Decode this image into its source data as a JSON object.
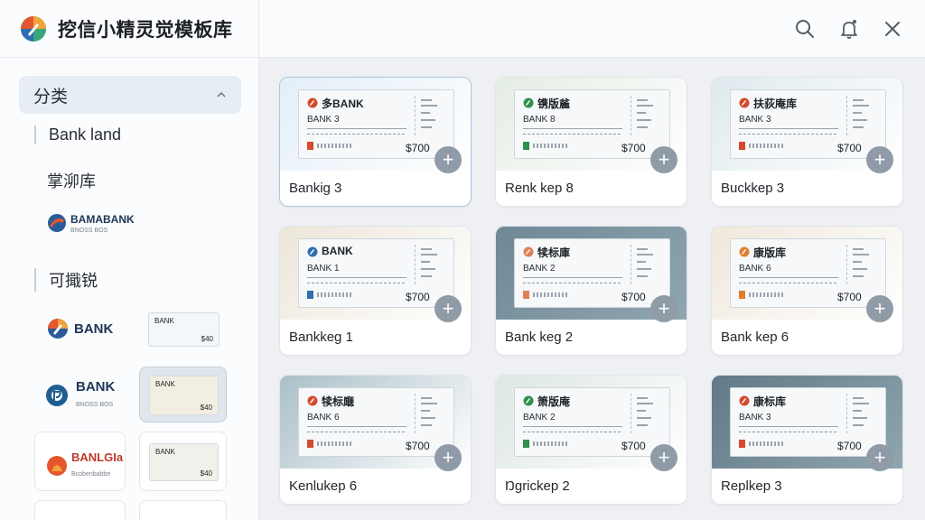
{
  "app": {
    "title": "挖信小精灵觉模板库"
  },
  "topbar": {
    "icons": [
      "search-icon",
      "bell-icon",
      "close-icon"
    ]
  },
  "sidebar": {
    "category_label": "分类",
    "items": [
      {
        "label": "Bank land"
      },
      {
        "label": "掌泖库"
      },
      {
        "label": "可擑锐"
      }
    ],
    "bank_logo": {
      "name": "BAMABANK",
      "sub": "BNOSS BOS"
    },
    "cards": [
      {
        "name": "BANK",
        "thumb_title": "BANK",
        "thumb_amount": "$40"
      },
      {
        "name": "BANK",
        "sub": "BNOSS BOS",
        "thumb_title": "BANK",
        "thumb_amount": "$40"
      },
      {
        "name": "BANLGIa",
        "sub": "Bcobenbabbe",
        "thumb_title": "BANK",
        "thumb_amount": "$40"
      }
    ]
  },
  "templates": [
    {
      "label": "Bankig 3",
      "ticket_title": "多BANK",
      "ticket_sub": "BANK 3",
      "amount": "$700",
      "bg": "#e3eef7",
      "selected": true,
      "accent": "#d44a2c"
    },
    {
      "label": "Renk kep 8",
      "ticket_title": "镌版麄",
      "ticket_sub": "BANK 8",
      "amount": "$700",
      "bg": "#e4ede4",
      "selected": false,
      "accent": "#2f8f4e"
    },
    {
      "label": "Buckkep 3",
      "ticket_title": "扶荻庵库",
      "ticket_sub": "BANK 3",
      "amount": "$700",
      "bg": "#dfeaee",
      "selected": false,
      "accent": "#d44a2c"
    },
    {
      "label": "Bankkeg 1",
      "ticket_title": "BANK",
      "ticket_sub": "BANK 1",
      "amount": "$700",
      "bg": "#ece6d9",
      "selected": false,
      "accent": "#2f6fb0"
    },
    {
      "label": "Bank keg 2",
      "ticket_title": "犊标庫",
      "ticket_sub": "BANK 2",
      "amount": "$700",
      "bg": "#6f8896",
      "selected": false,
      "accent": "#e07f55"
    },
    {
      "label": "Bank kep 6",
      "ticket_title": "康版库",
      "ticket_sub": "BANK 6",
      "amount": "$700",
      "bg": "#efe8dc",
      "selected": false,
      "accent": "#e07f2c"
    },
    {
      "label": "Kenlukep 6",
      "ticket_title": "犊标廰",
      "ticket_sub": "BANK 6",
      "amount": "$700",
      "bg": "#a9bfc7",
      "selected": false,
      "accent": "#d44a2c"
    },
    {
      "label": "Ŋgrickep 2",
      "ticket_title": "箫版庵",
      "ticket_sub": "BANK 2",
      "amount": "$700",
      "bg": "#dde7e2",
      "selected": false,
      "accent": "#2f8f4e"
    },
    {
      "label": "Replkep 3",
      "ticket_title": "康标库",
      "ticket_sub": "BANK 3",
      "amount": "$700",
      "bg": "#5f7a86",
      "selected": false,
      "accent": "#d44a2c"
    }
  ],
  "add_label": "+"
}
